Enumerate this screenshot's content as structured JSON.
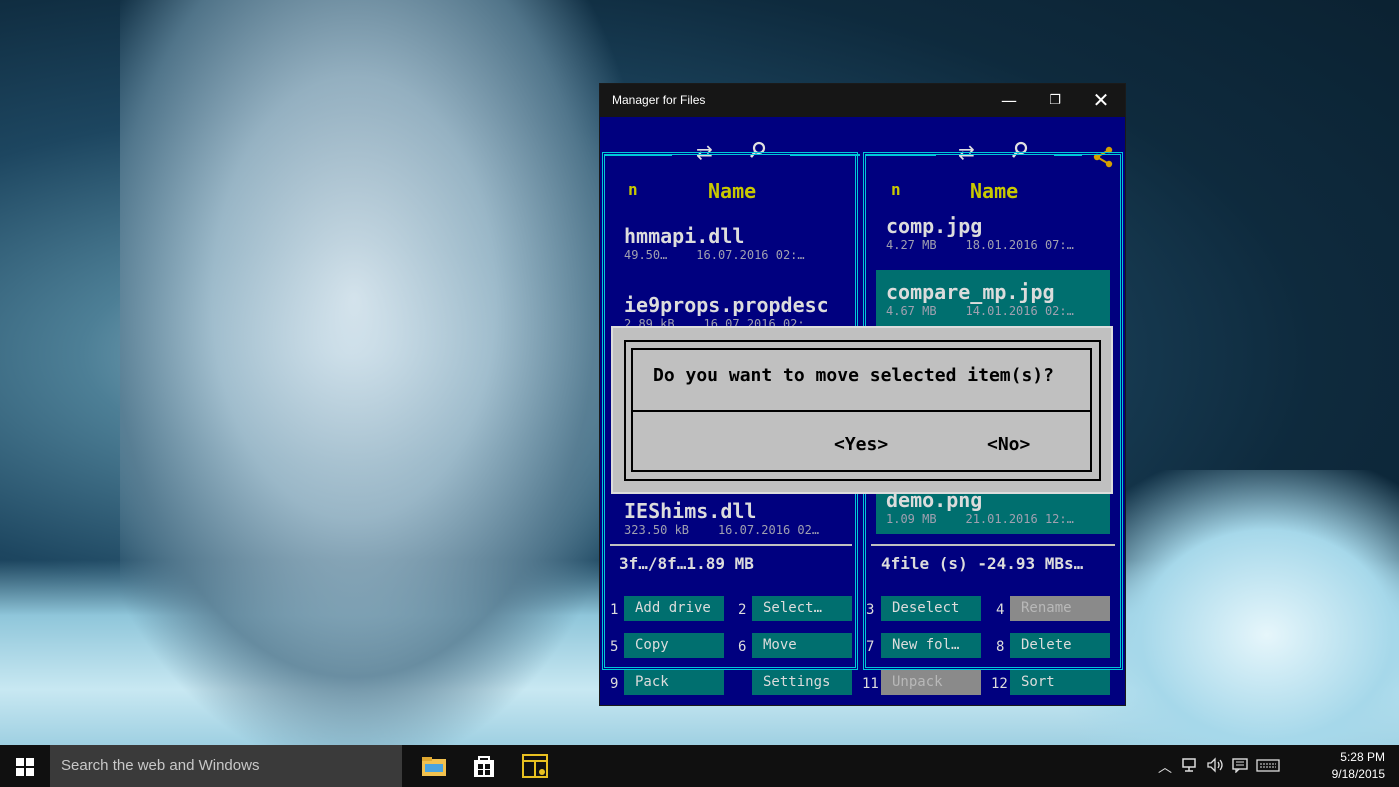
{
  "window": {
    "title": "Manager for Files",
    "controls": {
      "minimize": "—",
      "restore": "❐",
      "close": "✕"
    }
  },
  "left_panel": {
    "col_n": "n",
    "col_name": "Name",
    "files": [
      {
        "name": "hmmapi.dll",
        "size": "49.50…",
        "date": "16.07.2016 02:…"
      },
      {
        "name": "ie9props.propdesc",
        "size": "2.89 kB",
        "date": "16.07.2016 02:…"
      },
      {
        "name": "IEShims.dll",
        "size": "323.50 kB",
        "date": "16.07.2016 02…"
      }
    ],
    "status": "3f…/8f…1.89 MB"
  },
  "right_panel": {
    "col_n": "n",
    "col_name": "Name",
    "files": [
      {
        "name": "comp.jpg",
        "size": "4.27 MB",
        "date": "18.01.2016 07:…",
        "selected": false
      },
      {
        "name": "compare_mp.jpg",
        "size": "4.67 MB",
        "date": "14.01.2016 02:…",
        "selected": true
      },
      {
        "name": "demo.png",
        "size": "1.09 MB",
        "date": "21.01.2016 12:…",
        "selected": true
      }
    ],
    "status": "4file (s) -24.93 MBs…"
  },
  "function_keys": [
    {
      "num": "1",
      "label": "Add drive",
      "disabled": false
    },
    {
      "num": "2",
      "label": "Select…",
      "disabled": false
    },
    {
      "num": "3",
      "label": "Deselect",
      "disabled": false
    },
    {
      "num": "4",
      "label": "Rename",
      "disabled": true
    },
    {
      "num": "5",
      "label": "Copy",
      "disabled": false
    },
    {
      "num": "6",
      "label": "Move",
      "disabled": false
    },
    {
      "num": "7",
      "label": "New fol…",
      "disabled": false
    },
    {
      "num": "8",
      "label": "Delete",
      "disabled": false
    },
    {
      "num": "9",
      "label": "Pack",
      "disabled": false
    },
    {
      "num": "",
      "label": "Settings",
      "disabled": false
    },
    {
      "num": "11",
      "label": "Unpack",
      "disabled": true
    },
    {
      "num": "12",
      "label": "Sort",
      "disabled": false
    }
  ],
  "dialog": {
    "message": "Do you want to move selected item(s)?",
    "yes": "<Yes>",
    "no": "<No>"
  },
  "taskbar": {
    "search_placeholder": "Search the web and Windows",
    "time": "5:28 PM",
    "date": "9/18/2015"
  },
  "colors": {
    "panel_bg": "#00007f",
    "accent_cyan": "#00c8d8",
    "header_yellow": "#c8c800",
    "selected_teal": "#006f6f",
    "share_icon": "#d4a000"
  },
  "icons": [
    "refresh-icon",
    "search-icon",
    "share-icon",
    "windows-logo-icon",
    "file-explorer-icon",
    "store-icon",
    "file-manager-app-icon",
    "chevron-up-icon",
    "network-icon",
    "volume-icon",
    "action-center-icon",
    "keyboard-icon"
  ]
}
